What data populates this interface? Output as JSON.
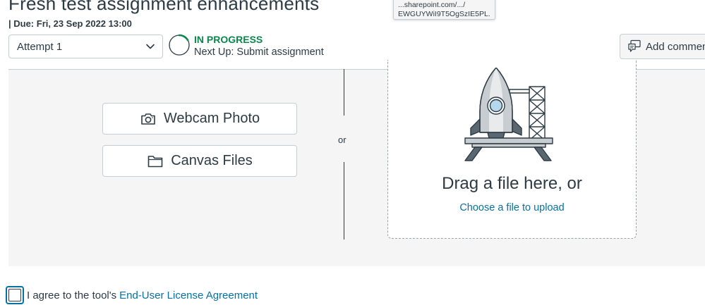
{
  "assignment": {
    "title": "Fresh test assignment enhancements",
    "due": "| Due: Fri, 23 Sep 2022 13:00"
  },
  "tooltip": {
    "line1": "...sharepoint.com/.../",
    "line2": "EWGUYWiI9T5OgSzIE5PL..."
  },
  "attempt_select": {
    "selected": "Attempt 1"
  },
  "status": {
    "label": "IN PROGRESS",
    "next_up": "Next Up: Submit assignment",
    "color": "#0b874b"
  },
  "add_comment": {
    "label": "Add comment"
  },
  "upload": {
    "webcam_label": "Webcam Photo",
    "canvas_files_label": "Canvas Files",
    "or_label": "or",
    "drag_text": "Drag a file here, or",
    "choose_link": "Choose a file to upload"
  },
  "agreement": {
    "prefix": "I agree to the tool's",
    "link": "End-User License Agreement",
    "checked": false
  },
  "icons": {
    "attempt_chevron": "chevron-down-icon",
    "progress": "progress-ring-icon",
    "comment": "comment-icon",
    "webcam": "camera-icon",
    "canvas_files": "folder-icon",
    "illustration": "rocket-launch-icon"
  },
  "colors": {
    "link": "#0770a3",
    "text": "#2d3b45",
    "panel_bg": "#f5f5f5",
    "border": "#c7cdd1"
  }
}
